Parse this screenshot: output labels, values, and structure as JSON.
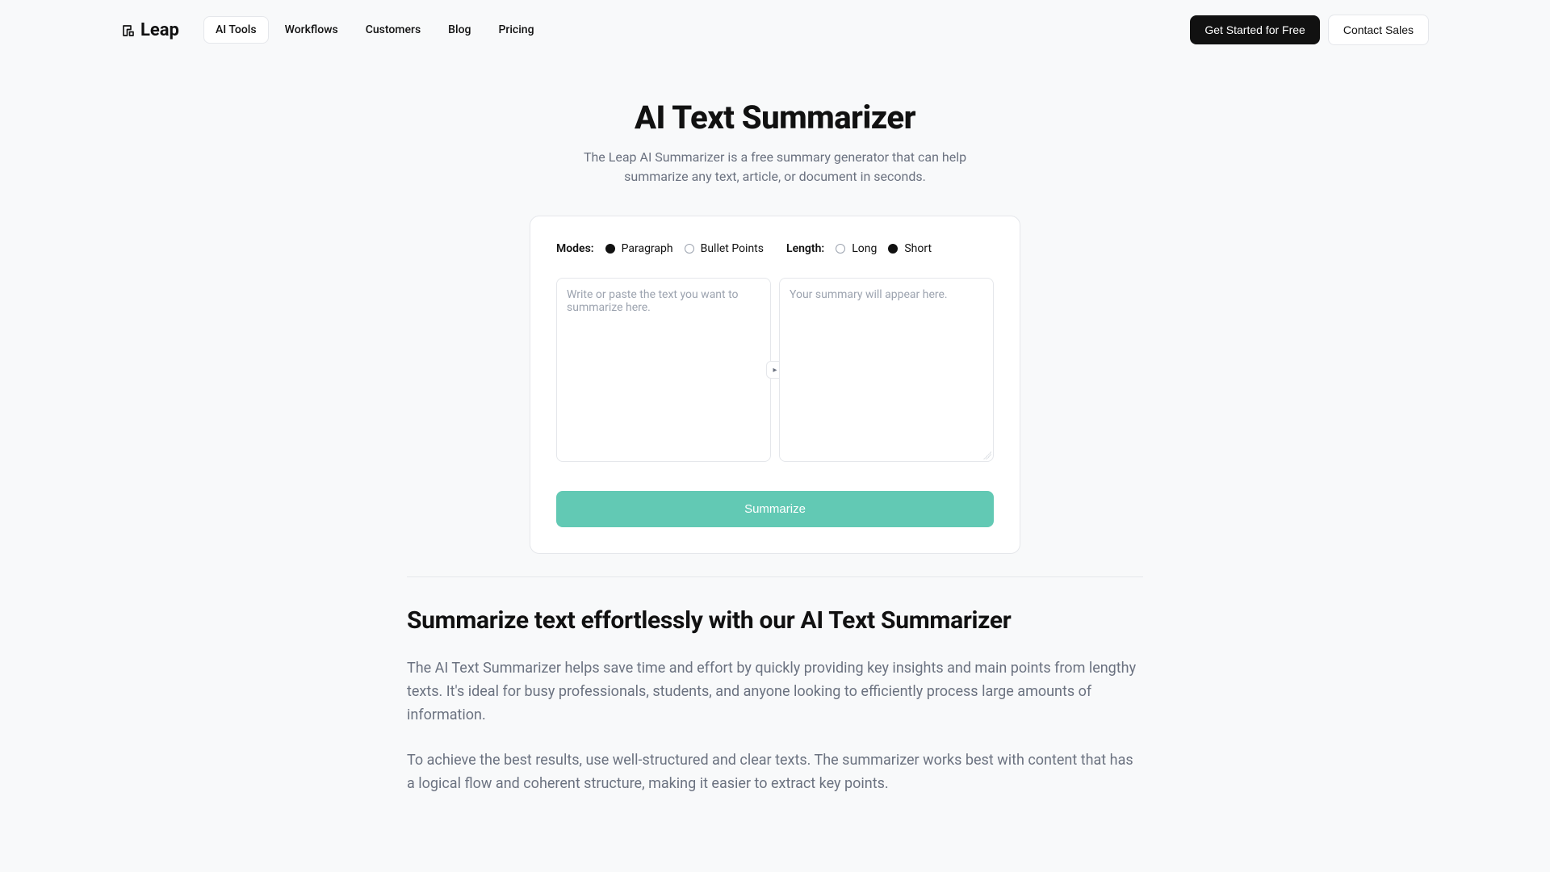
{
  "brand": "Leap",
  "nav": {
    "items": [
      {
        "label": "AI Tools",
        "active": true
      },
      {
        "label": "Workflows",
        "active": false
      },
      {
        "label": "Customers",
        "active": false
      },
      {
        "label": "Blog",
        "active": false
      },
      {
        "label": "Pricing",
        "active": false
      }
    ]
  },
  "header_cta": {
    "primary": "Get Started for Free",
    "secondary": "Contact Sales"
  },
  "hero": {
    "title": "AI Text Summarizer",
    "subtitle_line1": "The Leap AI Summarizer is a free summary generator that can help",
    "subtitle_line2": "summarize any text, article, or document in seconds."
  },
  "tool": {
    "modes_label": "Modes:",
    "modes": [
      {
        "label": "Paragraph",
        "selected": true
      },
      {
        "label": "Bullet Points",
        "selected": false
      }
    ],
    "length_label": "Length:",
    "lengths": [
      {
        "label": "Long",
        "selected": false
      },
      {
        "label": "Short",
        "selected": true
      }
    ],
    "input_placeholder": "Write or paste the text you want to summarize here.",
    "input_value": "",
    "output_placeholder": "Your summary will appear here.",
    "output_value": "",
    "action_label": "Summarize"
  },
  "content": {
    "heading": "Summarize text effortlessly with our AI Text Summarizer",
    "p1": "The AI Text Summarizer helps save time and effort by quickly providing key insights and main points from lengthy texts. It's ideal for busy professionals, students, and anyone looking to efficiently process large amounts of information.",
    "p2": "To achieve the best results, use well-structured and clear texts. The summarizer works best with content that has a logical flow and coherent structure, making it easier to extract key points."
  },
  "colors": {
    "accent": "#62c9b4",
    "text_muted": "#6b7280",
    "border": "#e5e7eb"
  }
}
